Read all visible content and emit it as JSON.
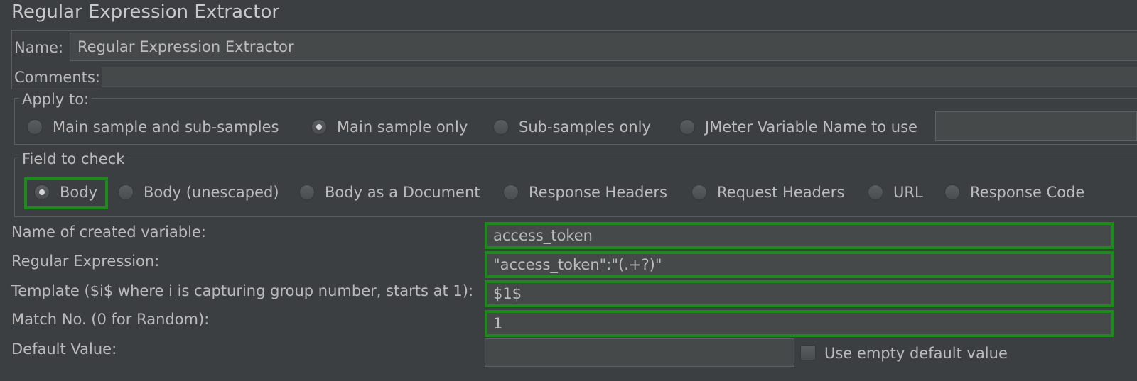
{
  "window": {
    "title": "Regular Expression Extractor"
  },
  "name_field": {
    "label": "Name:",
    "value": "Regular Expression Extractor"
  },
  "comments_field": {
    "label": "Comments:",
    "value": ""
  },
  "apply_to": {
    "legend": "Apply to:",
    "options": [
      {
        "label": "Main sample and sub-samples",
        "selected": false
      },
      {
        "label": "Main sample only",
        "selected": true
      },
      {
        "label": "Sub-samples only",
        "selected": false
      },
      {
        "label": "JMeter Variable Name to use",
        "selected": false
      }
    ],
    "variable_name_value": ""
  },
  "field_to_check": {
    "legend": "Field to check",
    "options": [
      {
        "label": "Body",
        "selected": true
      },
      {
        "label": "Body (unescaped)",
        "selected": false
      },
      {
        "label": "Body as a Document",
        "selected": false
      },
      {
        "label": "Response Headers",
        "selected": false
      },
      {
        "label": "Request Headers",
        "selected": false
      },
      {
        "label": "URL",
        "selected": false
      },
      {
        "label": "Response Code",
        "selected": false
      }
    ]
  },
  "form": {
    "var_name": {
      "label": "Name of created variable:",
      "value": "access_token"
    },
    "regex": {
      "label": "Regular Expression:",
      "value": "\"access_token\":\"(.+?)\""
    },
    "template": {
      "label": "Template ($i$ where i is capturing group number, starts at 1):",
      "value": "$1$"
    },
    "match_no": {
      "label": "Match No. (0 for Random):",
      "value": "1"
    },
    "default_value": {
      "label": "Default Value:",
      "value": ""
    },
    "use_empty_default": {
      "label": "Use empty default value",
      "checked": false
    }
  },
  "colors": {
    "background": "#3c3f41",
    "highlight": "#1e8a1e",
    "text": "#bbbbbb"
  }
}
